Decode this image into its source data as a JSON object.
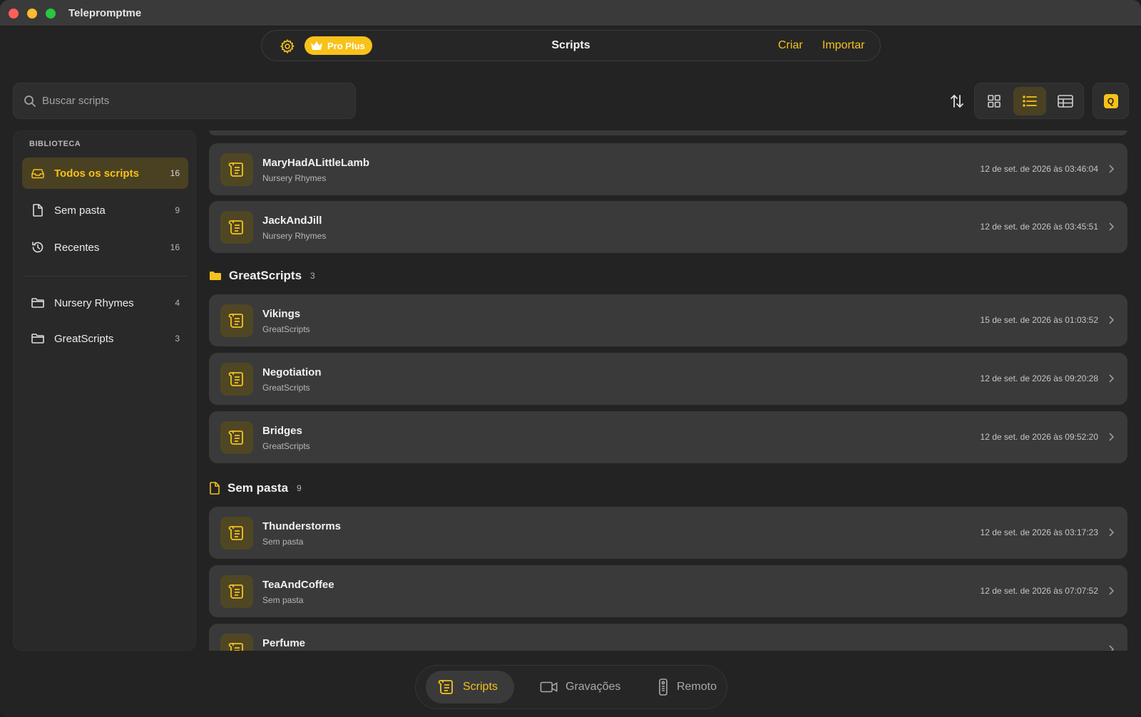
{
  "app": {
    "title": "Telepromptme"
  },
  "topbar": {
    "title": "Scripts",
    "pro_label": "Pro Plus",
    "create_label": "Criar",
    "import_label": "Importar"
  },
  "search": {
    "placeholder": "Buscar scripts",
    "value": ""
  },
  "view": {
    "mode": "list",
    "quick_label": "Q"
  },
  "colors": {
    "accent": "#f4c21b",
    "background": "#232323",
    "card": "#3a3a3a",
    "active_bg": "#4a4122"
  },
  "sidebar": {
    "section_label": "BIBLIOTECA",
    "items": [
      {
        "label": "Todos os scripts",
        "count": "16",
        "icon": "tray-icon",
        "active": true
      },
      {
        "label": "Sem pasta",
        "count": "9",
        "icon": "document-icon",
        "active": false
      },
      {
        "label": "Recentes",
        "count": "16",
        "icon": "history-icon",
        "active": false
      }
    ],
    "folders": [
      {
        "label": "Nursery Rhymes",
        "count": "4",
        "icon": "folder-icon"
      },
      {
        "label": "GreatScripts",
        "count": "3",
        "icon": "folder-icon"
      }
    ]
  },
  "list": {
    "top_rows": [
      {
        "title": "MaryHadALittleLamb",
        "folder": "Nursery Rhymes",
        "date": "12 de set. de 2026 às 03:46:04"
      },
      {
        "title": "JackAndJill",
        "folder": "Nursery Rhymes",
        "date": "12 de set. de 2026 às 03:45:51"
      }
    ],
    "groups": [
      {
        "name": "GreatScripts",
        "count": "3",
        "rows": [
          {
            "title": "Vikings",
            "folder": "GreatScripts",
            "date": "15 de set. de 2026 às 01:03:52"
          },
          {
            "title": "Negotiation",
            "folder": "GreatScripts",
            "date": "12 de set. de 2026 às 09:20:28"
          },
          {
            "title": "Bridges",
            "folder": "GreatScripts",
            "date": "12 de set. de 2026 às 09:52:20"
          }
        ]
      },
      {
        "name": "Sem pasta",
        "count": "9",
        "rows": [
          {
            "title": "Thunderstorms",
            "folder": "Sem pasta",
            "date": "12 de set. de 2026 às 03:17:23"
          },
          {
            "title": "TeaAndCoffee",
            "folder": "Sem pasta",
            "date": "12 de set. de 2026 às 07:07:52"
          },
          {
            "title": "Perfume",
            "folder": "",
            "date": ""
          }
        ]
      }
    ]
  },
  "tabs": [
    {
      "label": "Scripts",
      "icon": "scroll-icon",
      "active": true
    },
    {
      "label": "Gravações",
      "icon": "video-camera-icon",
      "active": false
    },
    {
      "label": "Remoto",
      "icon": "remote-icon",
      "active": false
    }
  ]
}
